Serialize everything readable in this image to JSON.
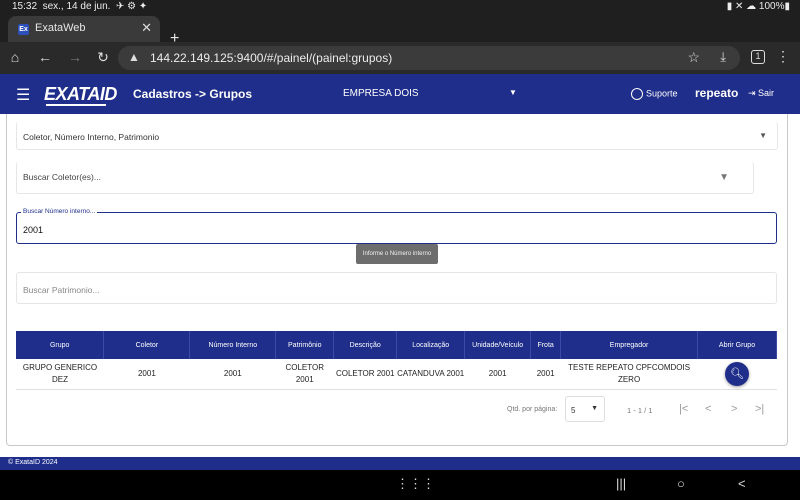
{
  "status": {
    "time": "15:32",
    "date": "sex., 14 de jun.",
    "icons_left": "✈ ⚙ ✦",
    "right": "▮ ✕ ☁ 100%▮"
  },
  "browser": {
    "tab_favicon": "Ex",
    "tab_title": "ExataWeb",
    "url": "144.22.149.125:9400/#/painel/(painel:grupos)",
    "tab_count": "1"
  },
  "header": {
    "logo_main": "EXATA",
    "logo_id": "ID",
    "breadcrumb": "Cadastros -> Grupos",
    "empresa": "EMPRESA DOIS",
    "suporte": "Suporte",
    "user": "repeato",
    "sair": "Sair"
  },
  "form": {
    "coletor_select": "Coletor, Número Interno, Patrimonio",
    "buscar_coletor_placeholder": "Buscar Coletor(es)...",
    "numero_interno_label": "Buscar Número interno...",
    "numero_interno_value": "2001",
    "tooltip": "Informe o Número interno",
    "buscar_patrimonio_placeholder": "Buscar Patrimonio..."
  },
  "table": {
    "headers": [
      "Grupo",
      "Coletor",
      "Número Interno",
      "Patrimônio",
      "Descrição",
      "Localização",
      "Unidade/Veículo",
      "Frota",
      "Empregador",
      "Abrir Grupo"
    ],
    "rows": [
      [
        "GRUPO GENERICO DEZ",
        "2001",
        "2001",
        "COLETOR 2001",
        "COLETOR 2001",
        "CATANDUVA 2001",
        "2001",
        "2001",
        "TESTE REPEATO CPFCOMDOIS ZERO"
      ]
    ]
  },
  "pager": {
    "label": "Qtd. por página:",
    "page_size": "5",
    "range": "1 - 1 / 1"
  },
  "footer": "© ExataID 2024",
  "colors": {
    "primary": "#1f2e8a",
    "browser_chrome": "#1f1f1f"
  }
}
